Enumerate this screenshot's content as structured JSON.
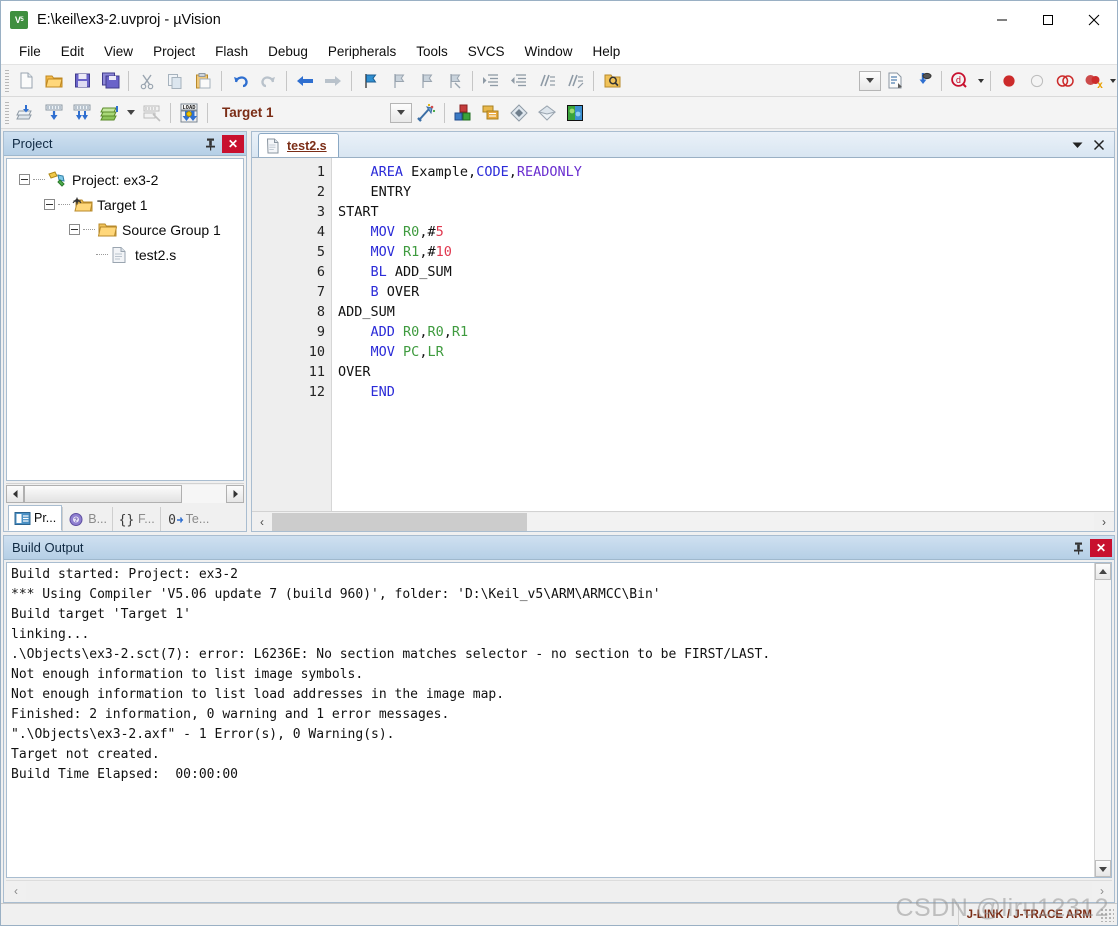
{
  "window": {
    "title": "E:\\keil\\ex3-2.uvproj - µVision",
    "app_icon": "keil-uvision-icon",
    "minimize_label": "minimize-icon",
    "maximize_label": "maximize-icon",
    "close_label": "close-icon"
  },
  "menubar": {
    "items": [
      {
        "label": "File"
      },
      {
        "label": "Edit"
      },
      {
        "label": "View"
      },
      {
        "label": "Project"
      },
      {
        "label": "Flash"
      },
      {
        "label": "Debug"
      },
      {
        "label": "Peripherals"
      },
      {
        "label": "Tools"
      },
      {
        "label": "SVCS"
      },
      {
        "label": "Window"
      },
      {
        "label": "Help"
      }
    ]
  },
  "toolbar_main": {
    "buttons": [
      "new-file-icon",
      "open-file-icon",
      "save-icon",
      "save-all-icon",
      "cut-icon",
      "copy-icon",
      "paste-icon",
      "undo-icon",
      "redo-icon",
      "navigate-back-icon",
      "navigate-forward-icon",
      "bookmark-toggle-icon",
      "bookmark-prev-icon",
      "bookmark-next-icon",
      "bookmark-clear-icon",
      "indent-icon",
      "outdent-icon",
      "comment-icon",
      "uncomment-icon",
      "find-in-files-icon"
    ],
    "right_buttons": [
      "dropdown-combo-icon",
      "insert-file-icon",
      "debug-settings-icon",
      "start-debug-icon",
      "breakpoint-icon",
      "breakpoint-disable-icon",
      "breakpoint-disable-all-icon",
      "breakpoint-kill-all-icon"
    ]
  },
  "toolbar_build": {
    "buttons": [
      "translate-icon",
      "build-icon",
      "rebuild-icon",
      "batch-build-icon",
      "stop-build-icon",
      "download-icon"
    ],
    "target_value": "Target 1",
    "target_dropdown": "target-dropdown-icon",
    "right_buttons": [
      "target-options-icon",
      "manage-components-icon",
      "multi-project-icon",
      "pack-installer-icon",
      "configuration-wizard-icon",
      "manage-runtime-icon"
    ]
  },
  "project_panel": {
    "title": "Project",
    "pin_icon": "pin-icon",
    "close_icon": "close-icon",
    "tree": [
      {
        "label": "Project: ex3-2",
        "icon": "project-icon",
        "depth": 0,
        "expanded": true
      },
      {
        "label": "Target 1",
        "icon": "target-folder-icon",
        "depth": 1,
        "expanded": true
      },
      {
        "label": "Source Group 1",
        "icon": "folder-icon",
        "depth": 2,
        "expanded": true
      },
      {
        "label": "test2.s",
        "icon": "assembly-file-icon",
        "depth": 3,
        "expanded": false
      }
    ],
    "tabs": [
      {
        "label": "Pr...",
        "icon": "project-tab-icon",
        "active": true
      },
      {
        "label": "B...",
        "icon": "books-tab-icon",
        "active": false
      },
      {
        "label": "F...",
        "icon": "functions-tab-icon",
        "active": false
      },
      {
        "label": "Te...",
        "icon": "templates-tab-icon",
        "active": false
      }
    ]
  },
  "editor": {
    "tabs": [
      {
        "label": "test2.s",
        "icon": "assembly-file-icon",
        "active": true
      }
    ],
    "dropdown_icon": "tab-list-icon",
    "close_icon": "close-icon",
    "line_numbers": [
      "1",
      "2",
      "3",
      "4",
      "5",
      "6",
      "7",
      "8",
      "9",
      "10",
      "11",
      "12"
    ],
    "lines": [
      {
        "n": 1,
        "tokens": [
          {
            "t": "    ",
            "c": "pl"
          },
          {
            "t": "AREA",
            "c": "kw"
          },
          {
            "t": " Example,",
            "c": "pl"
          },
          {
            "t": "CODE",
            "c": "kw"
          },
          {
            "t": ",",
            "c": "pl"
          },
          {
            "t": "READONLY",
            "c": "dir"
          }
        ]
      },
      {
        "n": 2,
        "tokens": [
          {
            "t": "    ENTRY",
            "c": "pl"
          }
        ]
      },
      {
        "n": 3,
        "tokens": [
          {
            "t": "START",
            "c": "pl"
          }
        ]
      },
      {
        "n": 4,
        "tokens": [
          {
            "t": "    ",
            "c": "pl"
          },
          {
            "t": "MOV",
            "c": "kw"
          },
          {
            "t": " ",
            "c": "pl"
          },
          {
            "t": "R0",
            "c": "reg"
          },
          {
            "t": ",#",
            "c": "pl"
          },
          {
            "t": "5",
            "c": "num"
          }
        ]
      },
      {
        "n": 5,
        "tokens": [
          {
            "t": "    ",
            "c": "pl"
          },
          {
            "t": "MOV",
            "c": "kw"
          },
          {
            "t": " ",
            "c": "pl"
          },
          {
            "t": "R1",
            "c": "reg"
          },
          {
            "t": ",#",
            "c": "pl"
          },
          {
            "t": "10",
            "c": "num"
          }
        ]
      },
      {
        "n": 6,
        "tokens": [
          {
            "t": "    ",
            "c": "pl"
          },
          {
            "t": "BL",
            "c": "kw"
          },
          {
            "t": " ADD_SUM",
            "c": "pl"
          }
        ]
      },
      {
        "n": 7,
        "tokens": [
          {
            "t": "    ",
            "c": "pl"
          },
          {
            "t": "B",
            "c": "kw"
          },
          {
            "t": " OVER",
            "c": "pl"
          }
        ]
      },
      {
        "n": 8,
        "tokens": [
          {
            "t": "ADD_SUM",
            "c": "pl"
          }
        ]
      },
      {
        "n": 9,
        "tokens": [
          {
            "t": "    ",
            "c": "pl"
          },
          {
            "t": "ADD",
            "c": "kw"
          },
          {
            "t": " ",
            "c": "pl"
          },
          {
            "t": "R0",
            "c": "reg"
          },
          {
            "t": ",",
            "c": "pl"
          },
          {
            "t": "R0",
            "c": "reg"
          },
          {
            "t": ",",
            "c": "pl"
          },
          {
            "t": "R1",
            "c": "reg"
          }
        ]
      },
      {
        "n": 10,
        "tokens": [
          {
            "t": "    ",
            "c": "pl"
          },
          {
            "t": "MOV",
            "c": "kw"
          },
          {
            "t": " ",
            "c": "pl"
          },
          {
            "t": "PC",
            "c": "reg"
          },
          {
            "t": ",",
            "c": "pl"
          },
          {
            "t": "LR",
            "c": "reg"
          }
        ]
      },
      {
        "n": 11,
        "tokens": [
          {
            "t": "OVER",
            "c": "pl"
          }
        ]
      },
      {
        "n": 12,
        "tokens": [
          {
            "t": "    ",
            "c": "pl"
          },
          {
            "t": "END",
            "c": "kw"
          }
        ]
      }
    ]
  },
  "build_output": {
    "title": "Build Output",
    "pin_icon": "pin-icon",
    "close_icon": "close-icon",
    "lines": [
      "Build started: Project: ex3-2",
      "*** Using Compiler 'V5.06 update 7 (build 960)', folder: 'D:\\Keil_v5\\ARM\\ARMCC\\Bin'",
      "Build target 'Target 1'",
      "linking...",
      ".\\Objects\\ex3-2.sct(7): error: L6236E: No section matches selector - no section to be FIRST/LAST.",
      "Not enough information to list image symbols.",
      "Not enough information to list load addresses in the image map.",
      "Finished: 2 information, 0 warning and 1 error messages.",
      "\".\\Objects\\ex3-2.axf\" - 1 Error(s), 0 Warning(s).",
      "Target not created.",
      "Build Time Elapsed:  00:00:00"
    ]
  },
  "statusbar": {
    "debugger": "J-LINK / J-TRACE ARM",
    "watermark": "CSDN @liru12312"
  },
  "colors": {
    "accent_blue": "#2b2bd8",
    "register_green": "#3f9b3f",
    "number_red": "#e0384f",
    "directive_purple": "#6a2fd0",
    "maroon": "#7b2d16",
    "close_red": "#c8102e",
    "panel_header": "#b5cfe6"
  }
}
